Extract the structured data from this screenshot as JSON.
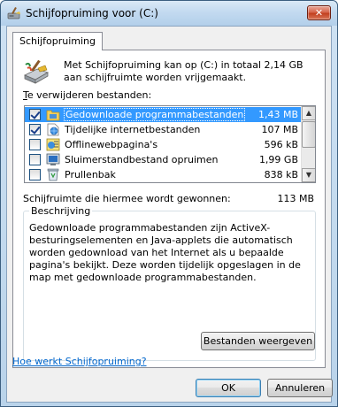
{
  "window": {
    "title": "Schijfopruiming voor  (C:)",
    "close_label": "✕"
  },
  "tab": {
    "label": "Schijfopruiming"
  },
  "intro": {
    "text": "Met Schijfopruiming kan op  (C:) in totaal 2,14 GB aan schijfruimte worden vrijgemaakt."
  },
  "list": {
    "label_mnemonic": "T",
    "label_rest": "e verwijderen bestanden:",
    "items": [
      {
        "name": "Gedownloade programmabestanden",
        "size": "1,43 MB",
        "checked": true,
        "selected": true,
        "icon": "folder-icon"
      },
      {
        "name": "Tijdelijke internetbestanden",
        "size": "107 MB",
        "checked": true,
        "selected": false,
        "icon": "internet-files-icon"
      },
      {
        "name": "Offlinewebpagina's",
        "size": "596 kB",
        "checked": false,
        "selected": false,
        "icon": "offline-pages-icon"
      },
      {
        "name": "Sluimerstandbestand opruimen",
        "size": "1,99 GB",
        "checked": false,
        "selected": false,
        "icon": "hibernation-icon"
      },
      {
        "name": "Prullenbak",
        "size": "838 kB",
        "checked": false,
        "selected": false,
        "icon": "recycle-bin-icon"
      }
    ]
  },
  "gain": {
    "label": "Schijfruimte die hiermee wordt gewonnen:",
    "value": "113 MB"
  },
  "description": {
    "title": "Beschrijving",
    "text": "Gedownloade programmabestanden zijn ActiveX-besturingselementen en Java-applets die automatisch worden gedownload van het Internet als u bepaalde pagina's bekijkt. Deze worden tijdelijk opgeslagen in de map met gedownloade programmabestanden.",
    "button_label": "Bestanden weergeven"
  },
  "help_link": "Hoe werkt Schijfopruiming?",
  "buttons": {
    "ok": "OK",
    "cancel": "Annuleren"
  },
  "colors": {
    "selection": "#3399ff",
    "link": "#0066cc",
    "close_button": "#c2401f"
  }
}
